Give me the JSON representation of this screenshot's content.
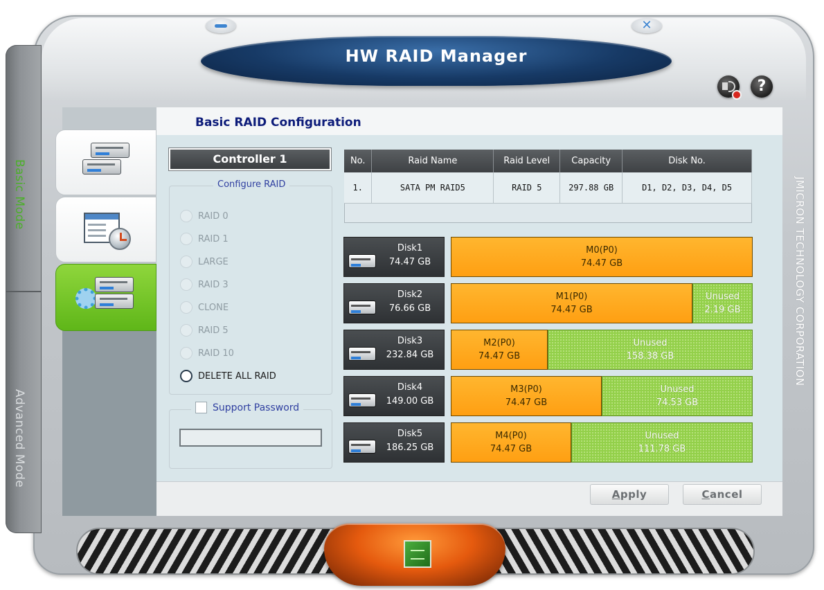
{
  "window": {
    "title": "HW RAID Manager",
    "minimize_icon": "minimize-icon",
    "close_icon": "close-icon",
    "sound_icon": "sound-muted-icon",
    "help_icon": "help-icon",
    "help_glyph": "?"
  },
  "side_rail": {
    "basic_mode": "Basic Mode",
    "advanced_mode": "Advanced Mode"
  },
  "vendor_text": "JMICRON TECHNOLOGY CORPORATION",
  "section_title": "Basic RAID Configuration",
  "controller": {
    "label": "Controller 1"
  },
  "configure": {
    "legend": "Configure RAID",
    "options": [
      {
        "label": "RAID 0",
        "enabled": false
      },
      {
        "label": "RAID 1",
        "enabled": false
      },
      {
        "label": "LARGE",
        "enabled": false
      },
      {
        "label": "RAID 3",
        "enabled": false
      },
      {
        "label": "CLONE",
        "enabled": false
      },
      {
        "label": "RAID 5",
        "enabled": false
      },
      {
        "label": "RAID 10",
        "enabled": false
      },
      {
        "label": "DELETE ALL RAID",
        "enabled": true
      }
    ]
  },
  "password": {
    "label": "Support Password",
    "checked": false,
    "value": ""
  },
  "raid_table": {
    "columns": [
      "No.",
      "Raid Name",
      "Raid Level",
      "Capacity",
      "Disk No."
    ],
    "rows": [
      [
        "1.",
        "SATA PM RAID5",
        "RAID 5",
        "297.88 GB",
        "D1, D2, D3, D4, D5"
      ]
    ]
  },
  "disks": [
    {
      "name": "Disk1",
      "size": "74.47 GB",
      "segments": [
        {
          "label": "M0(P0)",
          "size": "74.47 GB",
          "type": "used",
          "fraction": 1.0
        }
      ]
    },
    {
      "name": "Disk2",
      "size": "76.66 GB",
      "segments": [
        {
          "label": "M1(P0)",
          "size": "74.47 GB",
          "type": "used",
          "fraction": 0.8
        },
        {
          "label": "Unused",
          "size": "2.19 GB",
          "type": "unused",
          "fraction": 0.2
        }
      ]
    },
    {
      "name": "Disk3",
      "size": "232.84 GB",
      "segments": [
        {
          "label": "M2(P0)",
          "size": "74.47 GB",
          "type": "used",
          "fraction": 0.32
        },
        {
          "label": "Unused",
          "size": "158.38 GB",
          "type": "unused",
          "fraction": 0.68
        }
      ]
    },
    {
      "name": "Disk4",
      "size": "149.00 GB",
      "segments": [
        {
          "label": "M3(P0)",
          "size": "74.47 GB",
          "type": "used",
          "fraction": 0.5
        },
        {
          "label": "Unused",
          "size": "74.53 GB",
          "type": "unused",
          "fraction": 0.5
        }
      ]
    },
    {
      "name": "Disk5",
      "size": "186.25 GB",
      "segments": [
        {
          "label": "M4(P0)",
          "size": "74.47 GB",
          "type": "used",
          "fraction": 0.4
        },
        {
          "label": "Unused",
          "size": "111.78 GB",
          "type": "unused",
          "fraction": 0.6
        }
      ]
    }
  ],
  "buttons": {
    "apply_first": "A",
    "apply_rest": "pply",
    "cancel_first": "C",
    "cancel_rest": "ancel"
  },
  "colors": {
    "used": "#ffa820",
    "unused": "#93d04a",
    "title_bar": "#173a66",
    "accent_green": "#5fb619"
  }
}
